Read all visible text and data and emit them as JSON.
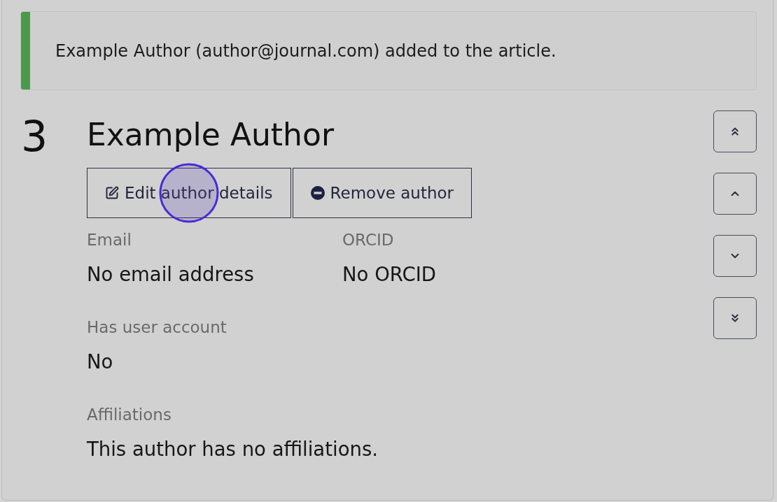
{
  "notification": {
    "kind": "success",
    "message": "Example Author (author@journal.com) added to the article."
  },
  "author": {
    "number": "3",
    "name": "Example Author",
    "actions": [
      {
        "kind": "edit",
        "label": "Edit author details"
      },
      {
        "kind": "remove",
        "label": "Remove author"
      }
    ],
    "field_rows": [
      {
        "fields": [
          {
            "label": "Email",
            "value": "No email address"
          },
          {
            "label": "ORCID",
            "value": "No ORCID"
          }
        ]
      },
      {
        "fields": [
          {
            "label": "Has user account",
            "value": "No"
          }
        ]
      },
      {
        "fields": [
          {
            "label": "Affiliations",
            "value": "This author has no affiliations."
          }
        ]
      }
    ]
  }
}
